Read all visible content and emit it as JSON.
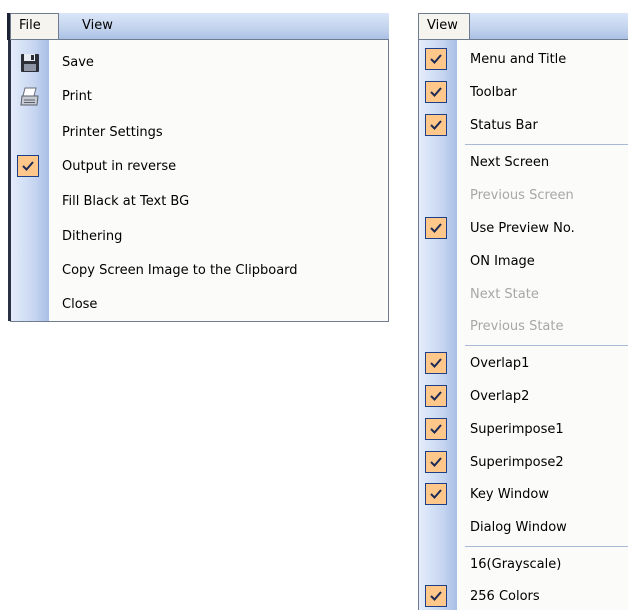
{
  "file_menu": {
    "menubar": {
      "file_label": "File",
      "view_label": "View"
    },
    "items": [
      {
        "label": "Save",
        "icon": "floppy-disk-icon",
        "checked": false
      },
      {
        "label": "Print",
        "icon": "printer-icon",
        "checked": false
      },
      {
        "label": "Printer Settings",
        "checked": false
      },
      {
        "label": "Output in reverse",
        "checked": true
      },
      {
        "label": "Fill Black at Text BG",
        "checked": false
      },
      {
        "label": "Dithering",
        "checked": false
      },
      {
        "label": "Copy Screen Image to the Clipboard",
        "checked": false
      },
      {
        "label": "Close",
        "checked": false
      }
    ]
  },
  "view_menu": {
    "menubar": {
      "view_label": "View"
    },
    "items": [
      {
        "label": "Menu and Title",
        "checked": true,
        "enabled": true
      },
      {
        "label": "Toolbar",
        "checked": true,
        "enabled": true
      },
      {
        "label": "Status Bar",
        "checked": true,
        "enabled": true
      },
      {
        "label": "Next Screen",
        "checked": false,
        "enabled": true
      },
      {
        "label": "Previous Screen",
        "checked": false,
        "enabled": false
      },
      {
        "label": "Use Preview No.",
        "checked": true,
        "enabled": true
      },
      {
        "label": "ON Image",
        "checked": false,
        "enabled": true
      },
      {
        "label": "Next State",
        "checked": false,
        "enabled": false
      },
      {
        "label": "Previous State",
        "checked": false,
        "enabled": false
      },
      {
        "label": "Overlap1",
        "checked": true,
        "enabled": true
      },
      {
        "label": "Overlap2",
        "checked": true,
        "enabled": true
      },
      {
        "label": "Superimpose1",
        "checked": true,
        "enabled": true
      },
      {
        "label": "Superimpose2",
        "checked": true,
        "enabled": true
      },
      {
        "label": "Key Window",
        "checked": true,
        "enabled": true
      },
      {
        "label": "Dialog Window",
        "checked": false,
        "enabled": true
      },
      {
        "label": "16(Grayscale)",
        "checked": false,
        "enabled": true
      },
      {
        "label": "256 Colors",
        "checked": true,
        "enabled": true
      }
    ]
  },
  "colors": {
    "check_fill": "#ffc88a",
    "check_border": "#1c3f86",
    "gutter": "#c7d6f1",
    "disabled_text": "#a7a7a7"
  }
}
